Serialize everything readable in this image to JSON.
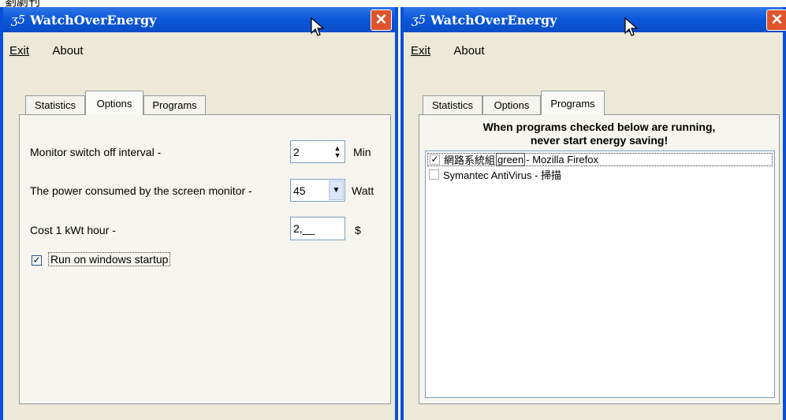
{
  "left_window": {
    "app_icon": "ʒ5",
    "title": "WatchOverEnergy",
    "close_symbol": "✕",
    "menu": {
      "exit": "Exit",
      "about": "About"
    },
    "tabs": [
      {
        "label": "Statistics"
      },
      {
        "label": "Options"
      },
      {
        "label": "Programs"
      }
    ],
    "active_tab": "Options",
    "options": {
      "monitor_label": "Monitor switch off interval -",
      "monitor_value": "2",
      "monitor_unit": "Min",
      "power_label": "The power consumed by the screen monitor -",
      "power_value": "45",
      "power_unit": "Watt",
      "cost_label": "Cost 1 kWt hour -",
      "cost_value": "2,__",
      "cost_unit": "$",
      "startup_label": "Run on windows startup",
      "startup_checked": true
    }
  },
  "right_window": {
    "app_icon": "ʒ5",
    "title": "WatchOverEnergy",
    "close_symbol": "✕",
    "menu": {
      "exit": "Exit",
      "about": "About"
    },
    "tabs": [
      {
        "label": "Statistics"
      },
      {
        "label": "Options"
      },
      {
        "label": "Programs"
      }
    ],
    "active_tab": "Programs",
    "programs": {
      "header_line1": "When programs checked below are running,",
      "header_line2": "never start energy saving!",
      "items": [
        {
          "prefix": "網路系統組",
          "tag": "green",
          "suffix": "- Mozilla Firefox",
          "checked": true
        },
        {
          "text": "Symantec AntiVirus - 掃描",
          "checked": false
        }
      ]
    }
  },
  "colors": {
    "titlebar": "#0b58d8",
    "window_bg": "#ece9d8",
    "close_button": "#e0542b"
  }
}
